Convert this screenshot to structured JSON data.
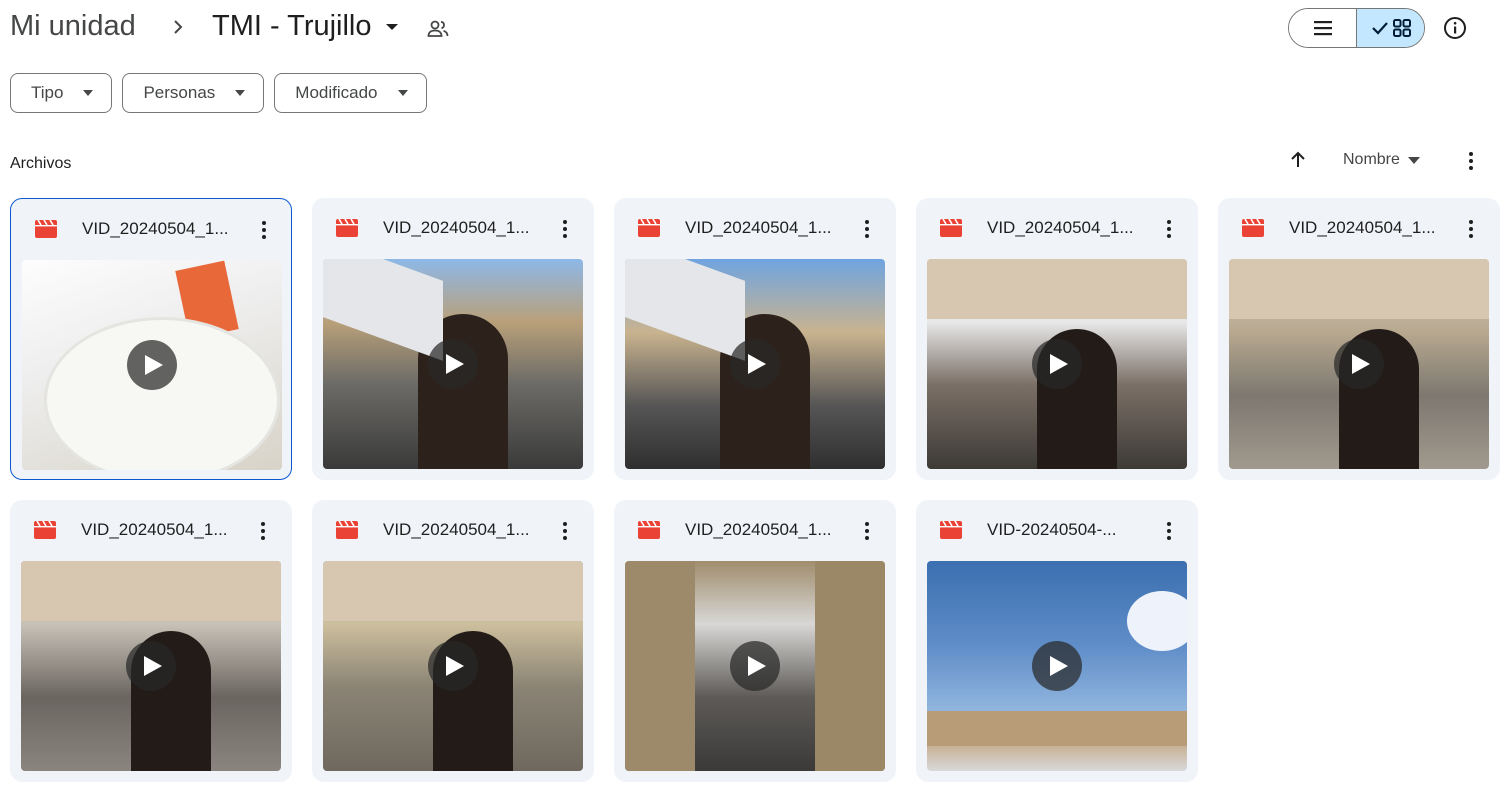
{
  "breadcrumb": {
    "root": "Mi unidad",
    "current": "TMI - Trujillo",
    "shared_icon": "people-icon"
  },
  "toolbar": {
    "view_list_icon": "list-view-icon",
    "view_grid_icon": "grid-view-icon",
    "active_view": "grid",
    "info_icon": "info-icon"
  },
  "filters": [
    {
      "label": "Tipo"
    },
    {
      "label": "Personas"
    },
    {
      "label": "Modificado"
    }
  ],
  "files_section": {
    "title": "Archivos",
    "sort_label": "Nombre",
    "sort_direction": "ascending"
  },
  "colors": {
    "accent": "#0b57d0",
    "selected_view_bg": "#c2e7ff",
    "card_bg": "#f0f4f9",
    "video_icon": "#ea4335"
  },
  "files": [
    {
      "name": "VID_20240504_1...",
      "type": "video",
      "selected": true
    },
    {
      "name": "VID_20240504_1...",
      "type": "video",
      "selected": false
    },
    {
      "name": "VID_20240504_1...",
      "type": "video",
      "selected": false
    },
    {
      "name": "VID_20240504_1...",
      "type": "video",
      "selected": false
    },
    {
      "name": "VID_20240504_1...",
      "type": "video",
      "selected": false
    },
    {
      "name": "VID_20240504_1...",
      "type": "video",
      "selected": false
    },
    {
      "name": "VID_20240504_1...",
      "type": "video",
      "selected": false
    },
    {
      "name": "VID_20240504_1...",
      "type": "video",
      "selected": false
    },
    {
      "name": "VID-20240504-...",
      "type": "video",
      "selected": false
    }
  ]
}
